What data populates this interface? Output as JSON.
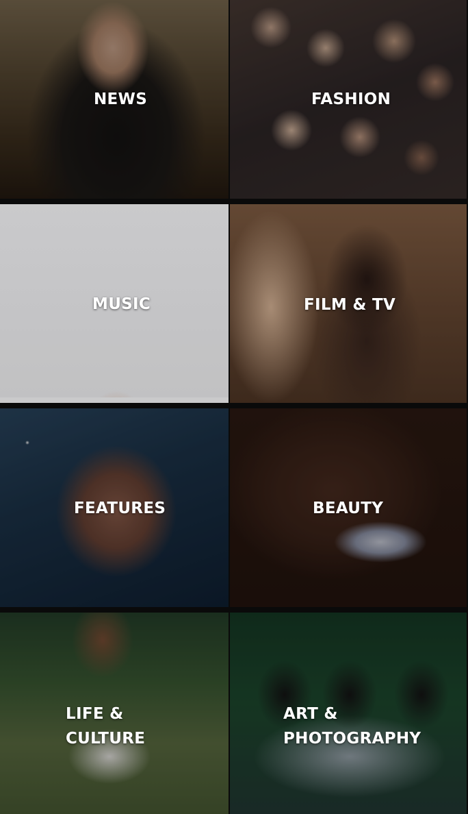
{
  "tiles": [
    {
      "id": "news",
      "label": "NEWS"
    },
    {
      "id": "fashion",
      "label": "FASHION"
    },
    {
      "id": "music",
      "label": "MUSIC"
    },
    {
      "id": "film",
      "label": "FILM & TV"
    },
    {
      "id": "features",
      "label": "FEATURES"
    },
    {
      "id": "beauty",
      "label": "BEAUTY"
    },
    {
      "id": "life",
      "label_lines": [
        "LIFE &",
        "CULTURE"
      ]
    },
    {
      "id": "art",
      "label_lines": [
        "ART &",
        "PHOTOGRAPHY"
      ]
    }
  ],
  "colors": {
    "background": "#000000",
    "label_text": "#ffffff"
  }
}
